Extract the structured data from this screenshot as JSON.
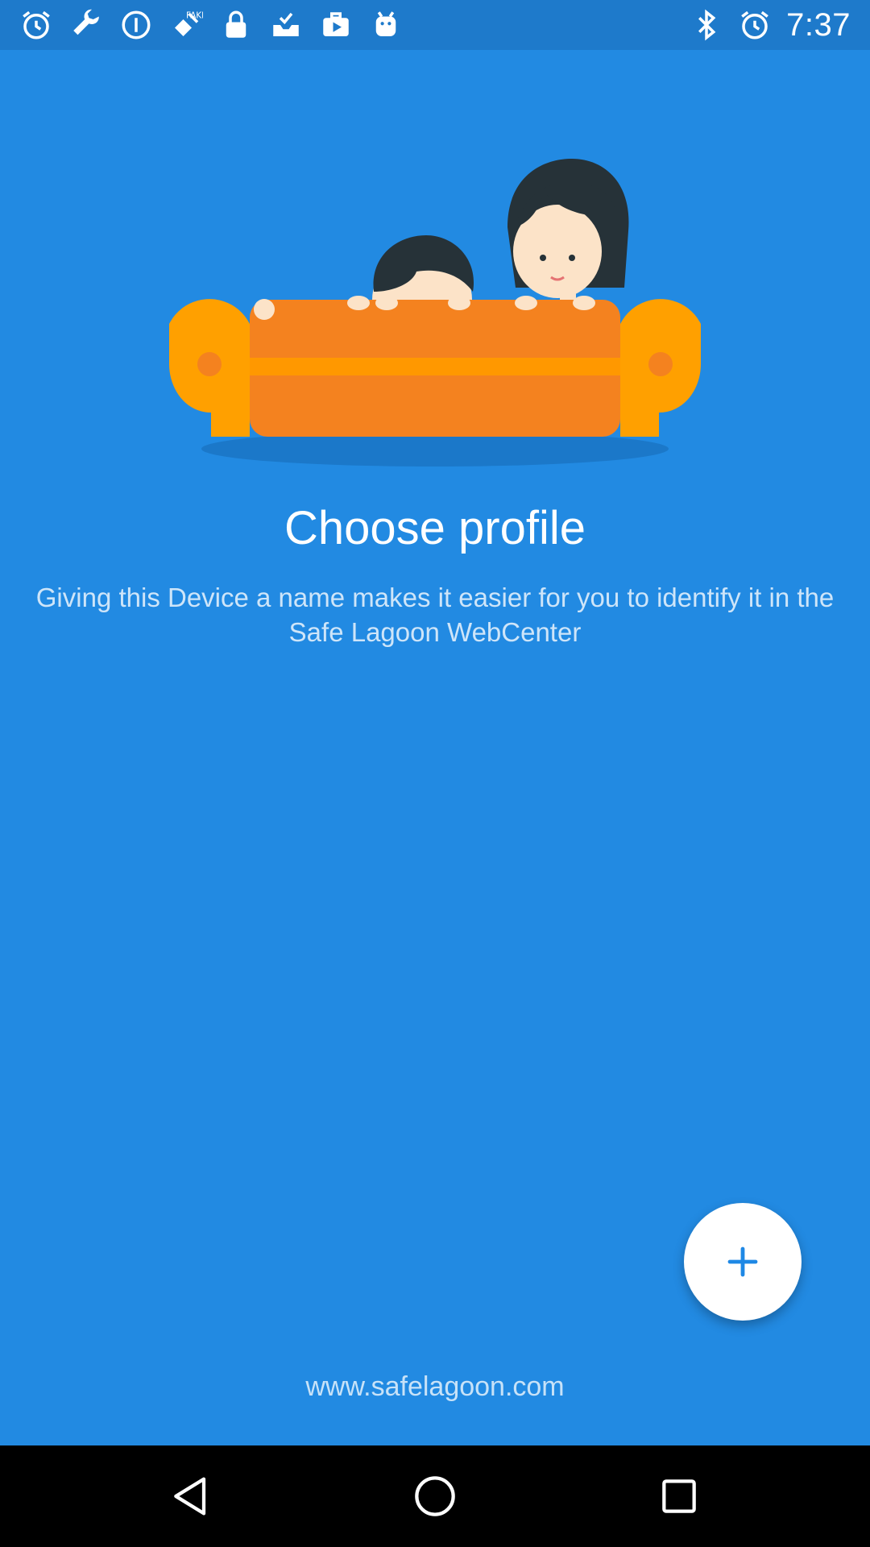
{
  "status_bar": {
    "time": "7:37",
    "left_icons": [
      "alarm-icon",
      "wrench-icon",
      "info-icon",
      "fake-gps-icon",
      "lock-icon",
      "inbox-check-icon",
      "briefcase-play-icon",
      "android-icon"
    ],
    "right_icons": [
      "bluetooth-icon",
      "alarm-icon"
    ]
  },
  "main": {
    "title": "Choose profile",
    "subtitle": "Giving this Device a name makes it easier for you to identify it in the Safe Lagoon WebCenter",
    "fab_icon": "plus-icon",
    "footer_link": "www.safelagoon.com"
  },
  "nav_bar": {
    "buttons": [
      "back-icon",
      "home-icon",
      "recents-icon"
    ]
  },
  "colors": {
    "background": "#228AE2",
    "status_bar": "#1E7ACB",
    "sofa_orange": "#F4821F",
    "sofa_arm": "#FFA000",
    "fab": "#FFFFFF",
    "accent": "#1E88E5"
  }
}
